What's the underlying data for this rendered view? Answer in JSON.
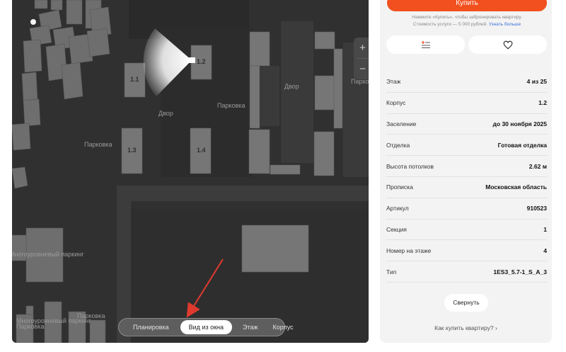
{
  "map": {
    "labels": {
      "dvor_left": "Двор",
      "dvor_right": "Двор",
      "parkovka_center": "Парковка",
      "parkovka_left": "Парковка",
      "parkovka_right": "Парков",
      "parkovka_bottom": "Парковка",
      "multilevel_1": "Многоуровневый паркинг",
      "multilevel_2": "Многоуровневый паркинг",
      "parkovka_bottom_small": "Парковка"
    },
    "buildings": {
      "b11": "1.1",
      "b12": "1.2",
      "b13": "1.3",
      "b14": "1.4"
    },
    "zoom": {
      "in": "+",
      "out": "−"
    },
    "view_tabs": {
      "plan": "Планировка",
      "window_view": "Вид из окна",
      "floor": "Этаж",
      "building": "Корпус"
    },
    "active_tab": "window_view"
  },
  "panel": {
    "buy_label": "Купить",
    "note_line1": "Нажмите «Купить», чтобы забронировать квартиру.",
    "note_line2": "Стоимость услуги — 5 000 рублей.",
    "note_link": "Узнать больше",
    "rows": [
      {
        "k": "Этаж",
        "v": "4 из 25"
      },
      {
        "k": "Корпус",
        "v": "1.2"
      },
      {
        "k": "Заселение",
        "v": "до 30 ноября 2025"
      },
      {
        "k": "Отделка",
        "v": "Готовая отделка"
      },
      {
        "k": "Высота потолков",
        "v": "2.62 м"
      },
      {
        "k": "Прописка",
        "v": "Московская область"
      },
      {
        "k": "Артикул",
        "v": "910523"
      },
      {
        "k": "Секция",
        "v": "1"
      },
      {
        "k": "Номер на этаже",
        "v": "4"
      },
      {
        "k": "Тип",
        "v": "1ES3_5.7-1_S_A_3"
      }
    ],
    "collapse_label": "Свернуть",
    "howto_label": "Как купить квартиру?",
    "howto_arrow": "›"
  },
  "colors": {
    "accent": "#f2501e",
    "map_bg": "#303030",
    "building": "#707070",
    "annotation_arrow": "#e03a2f"
  }
}
